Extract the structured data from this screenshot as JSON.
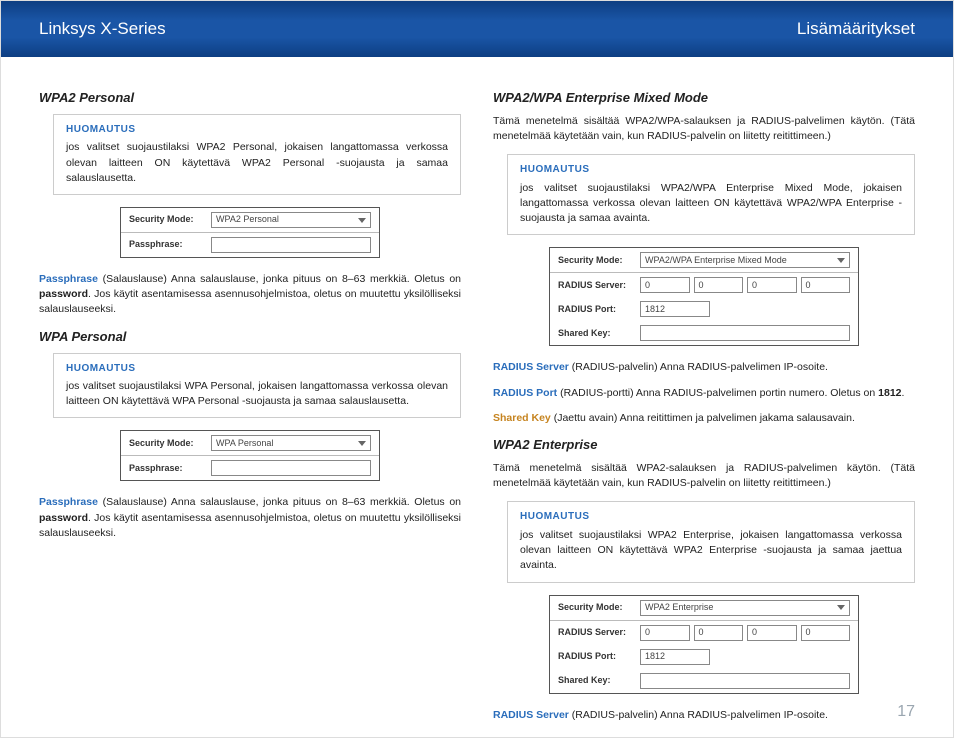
{
  "header": {
    "left": "Linksys X-Series",
    "right": "Lisämääritykset"
  },
  "pageNumber": "17",
  "labels": {
    "securityMode": "Security Mode:",
    "passphrase": "Passphrase:",
    "radiusServer": "RADIUS Server:",
    "radiusPort": "RADIUS Port:",
    "sharedKey": "Shared Key:"
  },
  "left": {
    "wpa2p": {
      "heading": "WPA2 Personal",
      "noteTitle": "HUOMAUTUS",
      "noteBody": "jos valitset suojaustilaksi WPA2 Personal, jokaisen langattomassa verkossa olevan laitteen ON käytettävä WPA2 Personal -suojausta ja samaa salauslausetta.",
      "modeValue": "WPA2 Personal",
      "paraTerm": "Passphrase",
      "para": "(Salauslause) Anna salauslause, jonka pituus on 8–63 merkkiä. Oletus on ",
      "para2": ". Jos käytit asentamisessa asennusohjelmistoa, oletus on muutettu yksilölliseksi salauslauseeksi.",
      "defaultWord": "password"
    },
    "wpap": {
      "heading": "WPA Personal",
      "noteTitle": "HUOMAUTUS",
      "noteBody": "jos valitset suojaustilaksi WPA Personal, jokaisen langattomassa verkossa olevan laitteen ON käytettävä WPA Personal -suojausta ja samaa salauslausetta.",
      "modeValue": "WPA Personal",
      "paraTerm": "Passphrase",
      "para": "(Salauslause) Anna salauslause, jonka pituus on 8–63 merkkiä. Oletus on ",
      "para2": ". Jos käytit asentamisessa asennusohjelmistoa, oletus on muutettu yksilölliseksi salauslauseeksi.",
      "defaultWord": "password"
    }
  },
  "right": {
    "mixed": {
      "heading": "WPA2/WPA Enterprise Mixed Mode",
      "intro": "Tämä menetelmä sisältää WPA2/WPA-salauksen ja RADIUS-palvelimen käytön. (Tätä menetelmää käytetään vain, kun RADIUS-palvelin on liitetty reitittimeen.)",
      "noteTitle": "HUOMAUTUS",
      "noteBody": "jos valitset suojaustilaksi WPA2/WPA Enterprise Mixed Mode, jokaisen langattomassa verkossa olevan laitteen ON käytettävä WPA2/WPA Enterprise -suojausta ja samaa avainta.",
      "modeValue": "WPA2/WPA Enterprise Mixed Mode",
      "ip": "0",
      "portValue": "1812",
      "p1Term": "RADIUS Server",
      "p1": "(RADIUS-palvelin) Anna RADIUS-palvelimen IP-osoite.",
      "p2Term": "RADIUS Port",
      "p2a": "(RADIUS-portti)  Anna RADIUS-palvelimen portin numero. Oletus on ",
      "p2b": "1812",
      "p2c": ".",
      "p3Term": "Shared Key",
      "p3": "(Jaettu avain) Anna reitittimen ja palvelimen jakama salausavain."
    },
    "enterprise": {
      "heading": "WPA2 Enterprise",
      "intro": "Tämä menetelmä sisältää WPA2-salauksen ja RADIUS-palvelimen käytön. (Tätä menetelmää käytetään vain, kun RADIUS-palvelin on liitetty reitittimeen.)",
      "noteTitle": "HUOMAUTUS",
      "noteBody": "jos valitset suojaustilaksi WPA2 Enterprise, jokaisen langattomassa verkossa olevan laitteen ON käytettävä WPA2 Enterprise -suojausta ja samaa jaettua avainta.",
      "modeValue": "WPA2 Enterprise",
      "ip": "0",
      "portValue": "1812",
      "p1Term": "RADIUS Server",
      "p1": "(RADIUS-palvelin) Anna RADIUS-palvelimen IP-osoite."
    }
  }
}
